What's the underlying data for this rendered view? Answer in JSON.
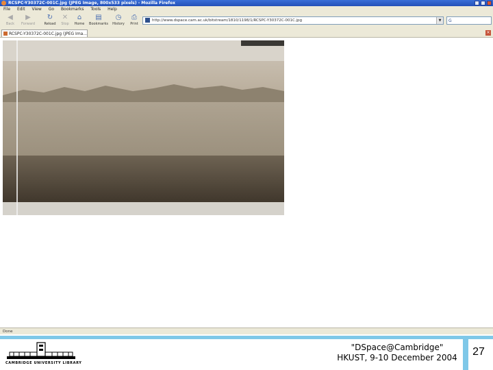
{
  "browser": {
    "window_title": "RCSPC-Y30372C-001C.jpg (JPEG Image, 800x533 pixels) - Mozilla Firefox",
    "menu": [
      "File",
      "Edit",
      "View",
      "Go",
      "Bookmarks",
      "Tools",
      "Help"
    ],
    "nav_buttons": [
      {
        "label": "Back",
        "icon": "back-arrow-icon",
        "enabled": false
      },
      {
        "label": "Forward",
        "icon": "forward-arrow-icon",
        "enabled": false
      },
      {
        "label": "Reload",
        "icon": "reload-icon",
        "enabled": true
      },
      {
        "label": "Stop",
        "icon": "stop-icon",
        "enabled": false
      },
      {
        "label": "Home",
        "icon": "home-icon",
        "enabled": true
      },
      {
        "label": "Bookmarks",
        "icon": "bookmarks-icon",
        "enabled": true
      },
      {
        "label": "History",
        "icon": "history-icon",
        "enabled": true
      },
      {
        "label": "Print",
        "icon": "print-icon",
        "enabled": true
      }
    ],
    "url": "http://www.dspace.cam.ac.uk/bitstream/1810/1198/1/RCSPC-Y30372C-001C.jpg",
    "go_box": "G",
    "tab_title": "RCSPC-Y30372C-001C.jpg (JPEG Ima...",
    "status": "Done"
  },
  "slide": {
    "logo_text": "CAMBRIDGE UNIVERSITY LIBRARY",
    "event_line1": "\"DSpace@Cambridge\"",
    "event_line2": "HKUST, 9-10 December 2004",
    "page_number": "27"
  },
  "colors": {
    "accent": "#7fc8e8",
    "titlebar": "#2350b8"
  }
}
